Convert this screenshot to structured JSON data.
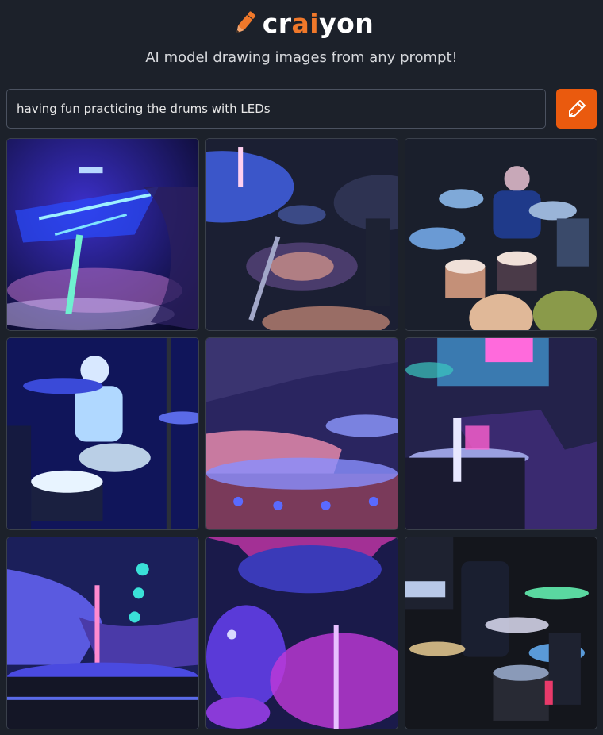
{
  "brand": {
    "name_prefix": "cr",
    "name_accent": "ai",
    "name_suffix": "yon",
    "tagline": "AI model drawing images from any prompt!",
    "accent_color": "#f0782a"
  },
  "prompt": {
    "value": "having fun practicing the drums with LEDs",
    "button_icon": "pencil-draw-icon",
    "button_color": "#ea5a0e"
  },
  "results": {
    "images": [
      {
        "icon": "drum-image"
      },
      {
        "icon": "drum-image"
      },
      {
        "icon": "drum-image"
      },
      {
        "icon": "drum-image"
      },
      {
        "icon": "drum-image"
      },
      {
        "icon": "drum-image"
      },
      {
        "icon": "drum-image"
      },
      {
        "icon": "drum-image"
      },
      {
        "icon": "drum-image"
      }
    ]
  }
}
